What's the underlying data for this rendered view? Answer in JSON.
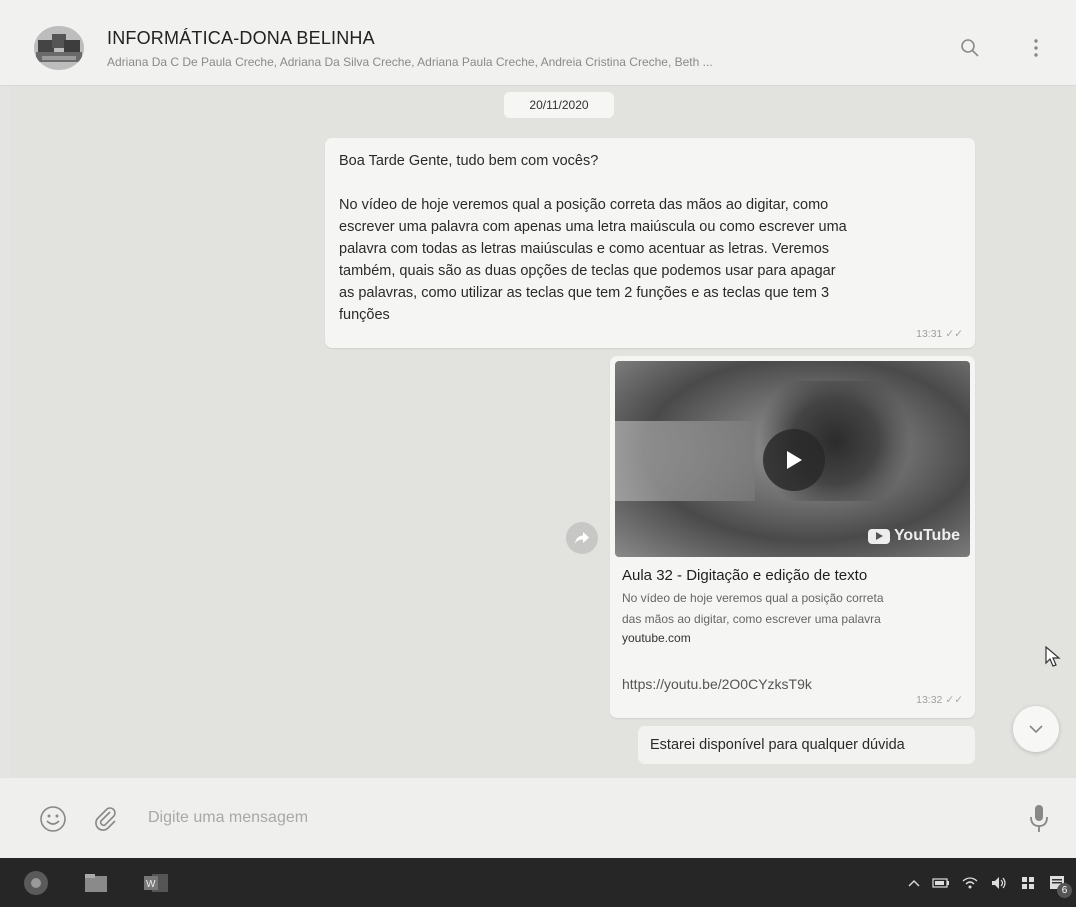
{
  "header": {
    "title": "INFORMÁTICA-DONA BELINHA",
    "participants": "Adriana Da C De Paula Creche, Adriana Da Silva Creche, Adriana Paula Creche, Andreia Cristina Creche, Beth ..."
  },
  "chat": {
    "date": "20/11/2020",
    "messages": [
      {
        "lines": [
          "Boa Tarde Gente, tudo bem com vocês?",
          "",
          "No vídeo de hoje veremos qual a posição correta das mãos ao digitar, como",
          "escrever uma palavra com apenas uma letra maiúscula ou como escrever uma",
          "palavra com todas as letras maiúsculas e como acentuar as letras. Veremos",
          "também, quais são as duas opções de teclas que podemos usar para apagar",
          "as palavras, como utilizar as teclas que tem 2 funções e as teclas que tem 3",
          "funções"
        ],
        "time": "13:31",
        "ticks": "✓✓"
      },
      {
        "preview_title": "Aula 32 - Digitação e edição de texto",
        "preview_desc_1": "No vídeo de hoje veremos qual a posição correta",
        "preview_desc_2": "das mãos ao digitar, como escrever uma palavra",
        "preview_domain": "youtube.com",
        "video_brand": "YouTube",
        "url": "https://youtu.be/2O0CYzksT9k",
        "time": "13:32",
        "ticks": "✓✓"
      },
      {
        "text": "Estarei disponível para qualquer dúvida"
      }
    ]
  },
  "compose": {
    "placeholder": "Digite uma mensagem"
  },
  "taskbar": {
    "notification_count": "6",
    "word_label": "W"
  },
  "colors": {
    "background": "#e2e2df",
    "bubble": "#f5f5f3",
    "taskbar": "#262626"
  }
}
